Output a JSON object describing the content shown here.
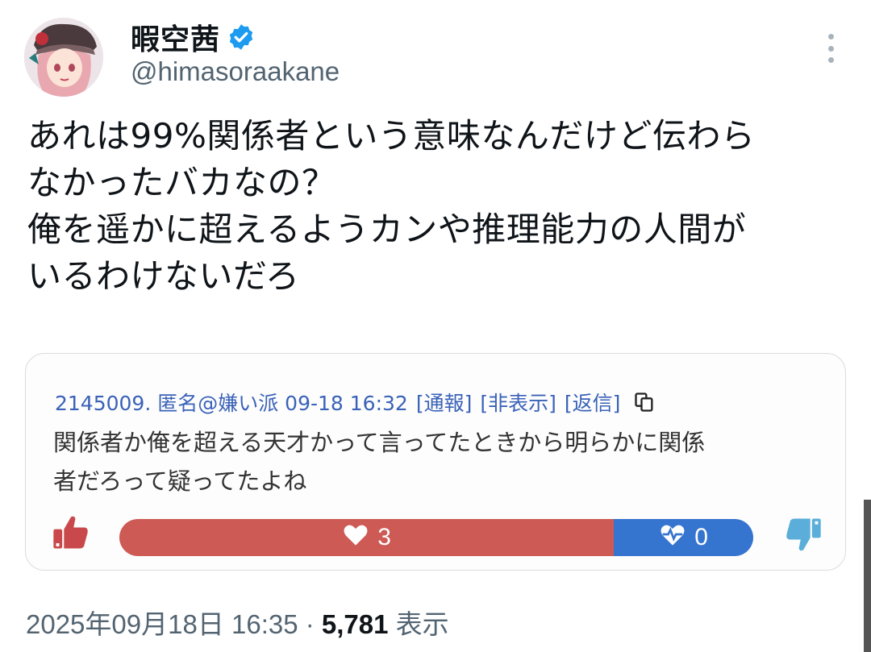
{
  "user": {
    "display_name": "暇空茜",
    "handle": "@himasoraakane"
  },
  "tweet": {
    "lines": [
      "あれは99%関係者という意味なんだけど伝わら",
      "なかったバカなの？",
      "俺を遥かに超えるようカンや推理能力の人間が",
      "いるわけないだろ"
    ]
  },
  "embedded_post": {
    "meta": "2145009. 匿名@嫌い派 09-18 16:32",
    "report_link": "[通報]",
    "hide_link": "[非表示]",
    "reply_link": "[返信]",
    "comment_lines": [
      "関係者か俺を超える天才かって言ってたときから明らかに関係",
      "者だろって疑ってたよね"
    ],
    "good_count": "3",
    "bad_count": "0",
    "good_fraction": 0.78
  },
  "footer": {
    "datetime": "2025年09月18日 16:35",
    "separator": " · ",
    "views": "5,781",
    "views_label": " 表示"
  },
  "colors": {
    "good_bar": "#cd5a55",
    "bad_bar": "#3574cf",
    "verified": "#1d9bf0",
    "link": "#3a62b8"
  }
}
